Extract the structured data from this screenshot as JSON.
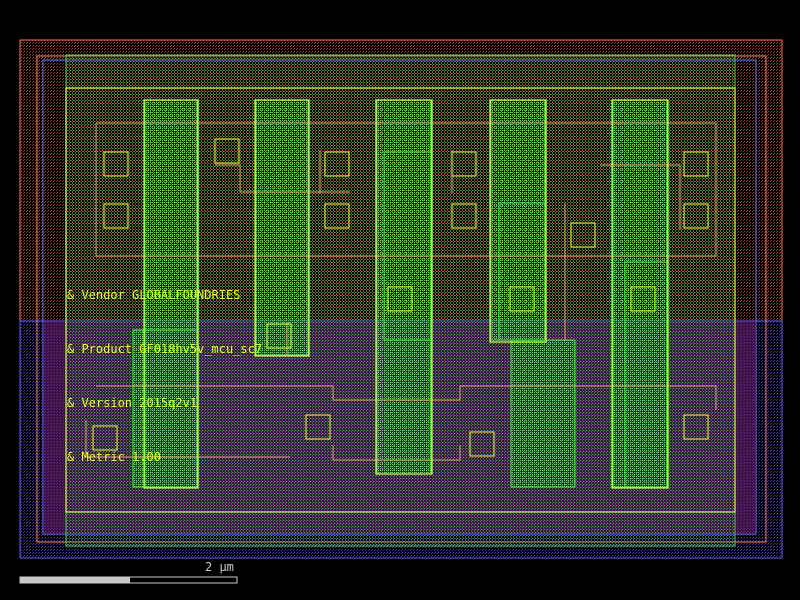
{
  "labels": {
    "vendor": "& Vendor GLOBALFOUNDRIES",
    "product": "& Product GF018hv5v_mcu_sc7",
    "version": "& Version 2015q2v1",
    "metric": "& Metric 1.00"
  },
  "scale_bar": {
    "text": "2 µm"
  },
  "colors": {
    "nwell": "#ff7050",
    "pwell": "#6a5cff",
    "diff": "#3cd23c",
    "poly": "#c8ff3c",
    "metal": "#ffb46e",
    "contact": "#e6ff3c",
    "label": "#e8ff2a"
  }
}
